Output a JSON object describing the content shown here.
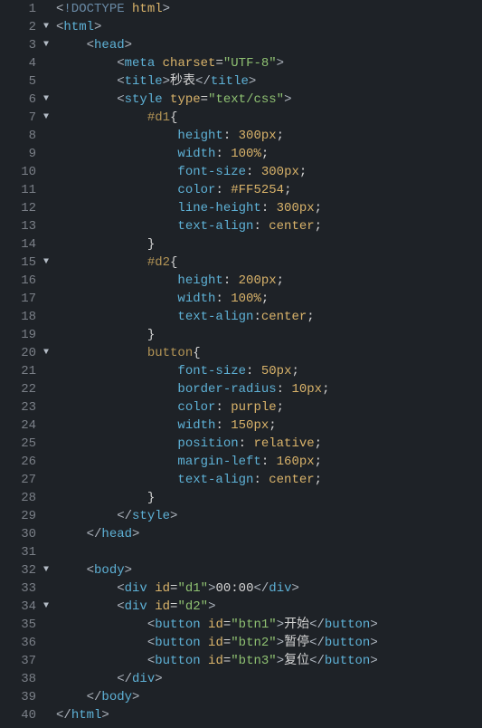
{
  "lines": [
    {
      "n": 1,
      "fold": "",
      "tokens": [
        [
          "ang",
          "<"
        ],
        [
          "doct",
          "!DOCTYPE "
        ],
        [
          "attr",
          "html"
        ],
        [
          "ang",
          ">"
        ]
      ]
    },
    {
      "n": 2,
      "fold": "▼",
      "tokens": [
        [
          "ang",
          "<"
        ],
        [
          "tag",
          "html"
        ],
        [
          "ang",
          ">"
        ]
      ]
    },
    {
      "n": 3,
      "fold": "▼",
      "tokens": [
        [
          "txt",
          "    "
        ],
        [
          "ang",
          "<"
        ],
        [
          "tag",
          "head"
        ],
        [
          "ang",
          ">"
        ]
      ]
    },
    {
      "n": 4,
      "fold": "",
      "tokens": [
        [
          "txt",
          "        "
        ],
        [
          "ang",
          "<"
        ],
        [
          "tag",
          "meta "
        ],
        [
          "attr",
          "charset"
        ],
        [
          "pun",
          "="
        ],
        [
          "str",
          "\"UTF-8\""
        ],
        [
          "ang",
          ">"
        ]
      ]
    },
    {
      "n": 5,
      "fold": "",
      "tokens": [
        [
          "txt",
          "        "
        ],
        [
          "ang",
          "<"
        ],
        [
          "tag",
          "title"
        ],
        [
          "ang",
          ">"
        ],
        [
          "txt",
          "秒表"
        ],
        [
          "ang",
          "</"
        ],
        [
          "tag",
          "title"
        ],
        [
          "ang",
          ">"
        ]
      ]
    },
    {
      "n": 6,
      "fold": "▼",
      "tokens": [
        [
          "txt",
          "        "
        ],
        [
          "ang",
          "<"
        ],
        [
          "tag",
          "style "
        ],
        [
          "attr",
          "type"
        ],
        [
          "pun",
          "="
        ],
        [
          "str",
          "\"text/css\""
        ],
        [
          "ang",
          ">"
        ]
      ]
    },
    {
      "n": 7,
      "fold": "▼",
      "tokens": [
        [
          "txt",
          "            "
        ],
        [
          "sel",
          "#d1"
        ],
        [
          "pun",
          "{"
        ]
      ]
    },
    {
      "n": 8,
      "fold": "",
      "tokens": [
        [
          "txt",
          "                "
        ],
        [
          "prop",
          "height"
        ],
        [
          "pun",
          ": "
        ],
        [
          "val",
          "300px"
        ],
        [
          "pun",
          ";"
        ]
      ]
    },
    {
      "n": 9,
      "fold": "",
      "tokens": [
        [
          "txt",
          "                "
        ],
        [
          "prop",
          "width"
        ],
        [
          "pun",
          ": "
        ],
        [
          "val",
          "100%"
        ],
        [
          "pun",
          ";"
        ]
      ]
    },
    {
      "n": 10,
      "fold": "",
      "tokens": [
        [
          "txt",
          "                "
        ],
        [
          "prop",
          "font-size"
        ],
        [
          "pun",
          ": "
        ],
        [
          "val",
          "300px"
        ],
        [
          "pun",
          ";"
        ]
      ]
    },
    {
      "n": 11,
      "fold": "",
      "tokens": [
        [
          "txt",
          "                "
        ],
        [
          "prop",
          "color"
        ],
        [
          "pun",
          ": "
        ],
        [
          "valhex",
          "#FF5254"
        ],
        [
          "pun",
          ";"
        ]
      ]
    },
    {
      "n": 12,
      "fold": "",
      "tokens": [
        [
          "txt",
          "                "
        ],
        [
          "prop",
          "line-height"
        ],
        [
          "pun",
          ": "
        ],
        [
          "val",
          "300px"
        ],
        [
          "pun",
          ";"
        ]
      ]
    },
    {
      "n": 13,
      "fold": "",
      "tokens": [
        [
          "txt",
          "                "
        ],
        [
          "prop",
          "text-align"
        ],
        [
          "pun",
          ": "
        ],
        [
          "val",
          "center"
        ],
        [
          "pun",
          ";"
        ]
      ]
    },
    {
      "n": 14,
      "fold": "",
      "tokens": [
        [
          "txt",
          "            "
        ],
        [
          "pun",
          "}"
        ]
      ]
    },
    {
      "n": 15,
      "fold": "▼",
      "tokens": [
        [
          "txt",
          "            "
        ],
        [
          "sel",
          "#d2"
        ],
        [
          "pun",
          "{"
        ]
      ]
    },
    {
      "n": 16,
      "fold": "",
      "tokens": [
        [
          "txt",
          "                "
        ],
        [
          "prop",
          "height"
        ],
        [
          "pun",
          ": "
        ],
        [
          "val",
          "200px"
        ],
        [
          "pun",
          ";"
        ]
      ]
    },
    {
      "n": 17,
      "fold": "",
      "tokens": [
        [
          "txt",
          "                "
        ],
        [
          "prop",
          "width"
        ],
        [
          "pun",
          ": "
        ],
        [
          "val",
          "100%"
        ],
        [
          "pun",
          ";"
        ]
      ]
    },
    {
      "n": 18,
      "fold": "",
      "tokens": [
        [
          "txt",
          "                "
        ],
        [
          "prop",
          "text-align"
        ],
        [
          "pun",
          ":"
        ],
        [
          "val",
          "center"
        ],
        [
          "pun",
          ";"
        ]
      ]
    },
    {
      "n": 19,
      "fold": "",
      "tokens": [
        [
          "txt",
          "            "
        ],
        [
          "pun",
          "}"
        ]
      ]
    },
    {
      "n": 20,
      "fold": "▼",
      "tokens": [
        [
          "txt",
          "            "
        ],
        [
          "sel",
          "button"
        ],
        [
          "pun",
          "{"
        ]
      ]
    },
    {
      "n": 21,
      "fold": "",
      "tokens": [
        [
          "txt",
          "                "
        ],
        [
          "prop",
          "font-size"
        ],
        [
          "pun",
          ": "
        ],
        [
          "val",
          "50px"
        ],
        [
          "pun",
          ";"
        ]
      ]
    },
    {
      "n": 22,
      "fold": "",
      "tokens": [
        [
          "txt",
          "                "
        ],
        [
          "prop",
          "border-radius"
        ],
        [
          "pun",
          ": "
        ],
        [
          "val",
          "10px"
        ],
        [
          "pun",
          ";"
        ]
      ]
    },
    {
      "n": 23,
      "fold": "",
      "tokens": [
        [
          "txt",
          "                "
        ],
        [
          "prop",
          "color"
        ],
        [
          "pun",
          ": "
        ],
        [
          "val",
          "purple"
        ],
        [
          "pun",
          ";"
        ]
      ]
    },
    {
      "n": 24,
      "fold": "",
      "tokens": [
        [
          "txt",
          "                "
        ],
        [
          "prop",
          "width"
        ],
        [
          "pun",
          ": "
        ],
        [
          "val",
          "150px"
        ],
        [
          "pun",
          ";"
        ]
      ]
    },
    {
      "n": 25,
      "fold": "",
      "tokens": [
        [
          "txt",
          "                "
        ],
        [
          "prop",
          "position"
        ],
        [
          "pun",
          ": "
        ],
        [
          "val",
          "relative"
        ],
        [
          "pun",
          ";"
        ]
      ]
    },
    {
      "n": 26,
      "fold": "",
      "tokens": [
        [
          "txt",
          "                "
        ],
        [
          "prop",
          "margin-left"
        ],
        [
          "pun",
          ": "
        ],
        [
          "val",
          "160px"
        ],
        [
          "pun",
          ";"
        ]
      ]
    },
    {
      "n": 27,
      "fold": "",
      "tokens": [
        [
          "txt",
          "                "
        ],
        [
          "prop",
          "text-align"
        ],
        [
          "pun",
          ": "
        ],
        [
          "val",
          "center"
        ],
        [
          "pun",
          ";"
        ]
      ]
    },
    {
      "n": 28,
      "fold": "",
      "tokens": [
        [
          "txt",
          "            "
        ],
        [
          "pun",
          "}"
        ]
      ]
    },
    {
      "n": 29,
      "fold": "",
      "tokens": [
        [
          "txt",
          "        "
        ],
        [
          "ang",
          "</"
        ],
        [
          "tag",
          "style"
        ],
        [
          "ang",
          ">"
        ]
      ]
    },
    {
      "n": 30,
      "fold": "",
      "tokens": [
        [
          "txt",
          "    "
        ],
        [
          "ang",
          "</"
        ],
        [
          "tag",
          "head"
        ],
        [
          "ang",
          ">"
        ]
      ]
    },
    {
      "n": 31,
      "fold": "",
      "tokens": []
    },
    {
      "n": 32,
      "fold": "▼",
      "tokens": [
        [
          "txt",
          "    "
        ],
        [
          "ang",
          "<"
        ],
        [
          "tag",
          "body"
        ],
        [
          "ang",
          ">"
        ]
      ]
    },
    {
      "n": 33,
      "fold": "",
      "tokens": [
        [
          "txt",
          "        "
        ],
        [
          "ang",
          "<"
        ],
        [
          "tag",
          "div "
        ],
        [
          "attr",
          "id"
        ],
        [
          "pun",
          "="
        ],
        [
          "str",
          "\"d1\""
        ],
        [
          "ang",
          ">"
        ],
        [
          "txt",
          "00:00"
        ],
        [
          "ang",
          "</"
        ],
        [
          "tag",
          "div"
        ],
        [
          "ang",
          ">"
        ]
      ]
    },
    {
      "n": 34,
      "fold": "▼",
      "tokens": [
        [
          "txt",
          "        "
        ],
        [
          "ang",
          "<"
        ],
        [
          "tag",
          "div "
        ],
        [
          "attr",
          "id"
        ],
        [
          "pun",
          "="
        ],
        [
          "str",
          "\"d2\""
        ],
        [
          "ang",
          ">"
        ]
      ]
    },
    {
      "n": 35,
      "fold": "",
      "tokens": [
        [
          "txt",
          "            "
        ],
        [
          "ang",
          "<"
        ],
        [
          "tag",
          "button "
        ],
        [
          "attr",
          "id"
        ],
        [
          "pun",
          "="
        ],
        [
          "str",
          "\"btn1\""
        ],
        [
          "ang",
          ">"
        ],
        [
          "txt",
          "开始"
        ],
        [
          "ang",
          "</"
        ],
        [
          "tag",
          "button"
        ],
        [
          "ang",
          ">"
        ]
      ]
    },
    {
      "n": 36,
      "fold": "",
      "tokens": [
        [
          "txt",
          "            "
        ],
        [
          "ang",
          "<"
        ],
        [
          "tag",
          "button "
        ],
        [
          "attr",
          "id"
        ],
        [
          "pun",
          "="
        ],
        [
          "str",
          "\"btn2\""
        ],
        [
          "ang",
          ">"
        ],
        [
          "txt",
          "暂停"
        ],
        [
          "ang",
          "</"
        ],
        [
          "tag",
          "button"
        ],
        [
          "ang",
          ">"
        ]
      ]
    },
    {
      "n": 37,
      "fold": "",
      "tokens": [
        [
          "txt",
          "            "
        ],
        [
          "ang",
          "<"
        ],
        [
          "tag",
          "button "
        ],
        [
          "attr",
          "id"
        ],
        [
          "pun",
          "="
        ],
        [
          "str",
          "\"btn3\""
        ],
        [
          "ang",
          ">"
        ],
        [
          "txt",
          "复位"
        ],
        [
          "ang",
          "</"
        ],
        [
          "tag",
          "button"
        ],
        [
          "ang",
          ">"
        ]
      ]
    },
    {
      "n": 38,
      "fold": "",
      "tokens": [
        [
          "txt",
          "        "
        ],
        [
          "ang",
          "</"
        ],
        [
          "tag",
          "div"
        ],
        [
          "ang",
          ">"
        ]
      ]
    },
    {
      "n": 39,
      "fold": "",
      "tokens": [
        [
          "txt",
          "    "
        ],
        [
          "ang",
          "</"
        ],
        [
          "tag",
          "body"
        ],
        [
          "ang",
          ">"
        ]
      ]
    },
    {
      "n": 40,
      "fold": "",
      "tokens": [
        [
          "ang",
          "</"
        ],
        [
          "tag",
          "html"
        ],
        [
          "ang",
          ">"
        ]
      ]
    }
  ]
}
